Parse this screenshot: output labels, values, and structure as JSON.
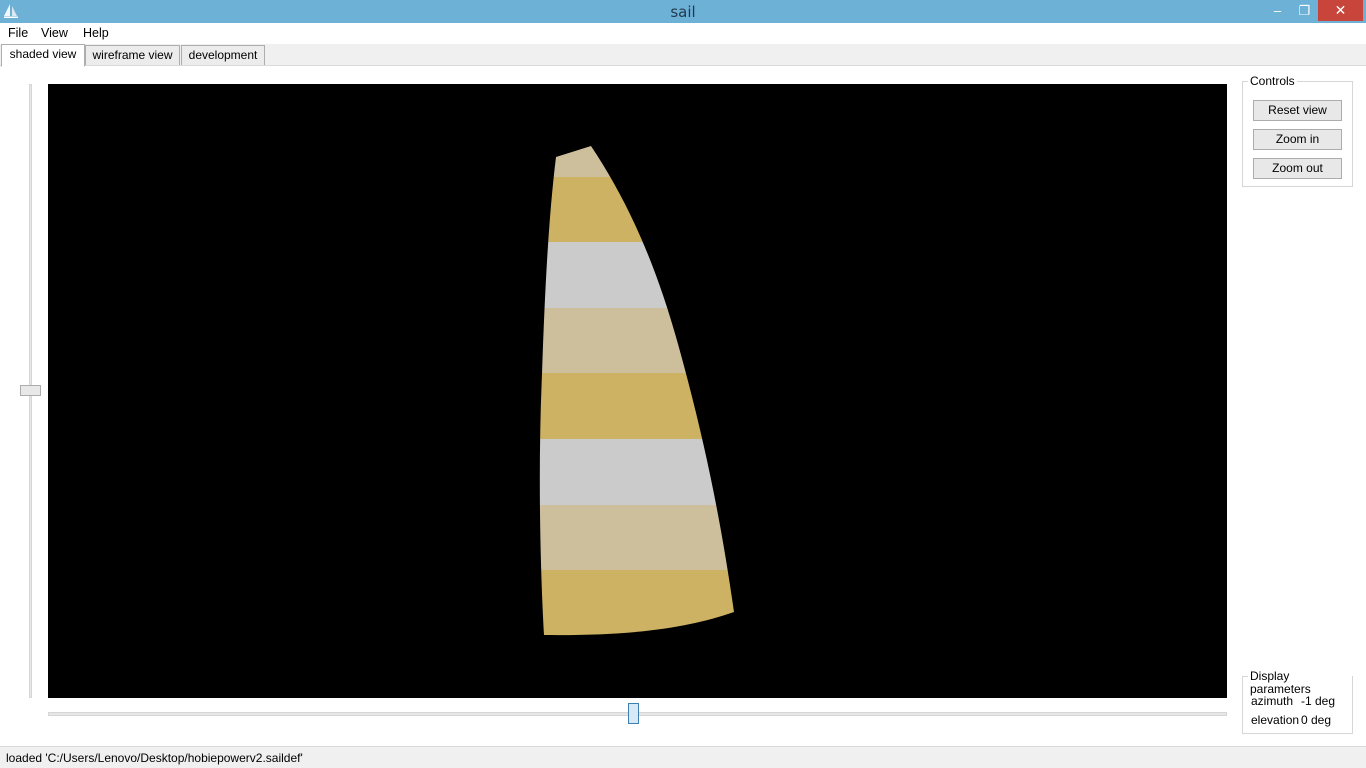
{
  "window": {
    "title": "sail",
    "minimize_glyph": "‒",
    "maximize_glyph": "❐",
    "close_glyph": "✕"
  },
  "menu": [
    "File",
    "View",
    "Help"
  ],
  "tabs": [
    {
      "label": "shaded view",
      "active": true
    },
    {
      "label": "wireframe view",
      "active": false
    },
    {
      "label": "development",
      "active": false
    }
  ],
  "controls": {
    "title": "Controls",
    "reset_label": "Reset view",
    "zoom_in_label": "Zoom in",
    "zoom_out_label": "Zoom out"
  },
  "display_parameters": {
    "title": "Display parameters",
    "azimuth_label": "azimuth",
    "azimuth_value": "-1 deg",
    "elevation_label": "elevation",
    "elevation_value": "0 deg"
  },
  "viewport": {
    "background_color": "#000000",
    "panel_colors": [
      "#cdbf9c",
      "#cdb263",
      "#cbcbcb",
      "#cdbf9c",
      "#cdb263",
      "#cbcbcb",
      "#cdbf9c",
      "#cdb263"
    ]
  },
  "sliders": {
    "vertical_position": 0.5,
    "horizontal_position": 0.5
  },
  "status": {
    "text": "loaded 'C:/Users/Lenovo/Desktop/hobiepowerv2.saildef'"
  },
  "colors": {
    "titlebar": "#6eb1d6",
    "close_button": "#c7453a"
  }
}
